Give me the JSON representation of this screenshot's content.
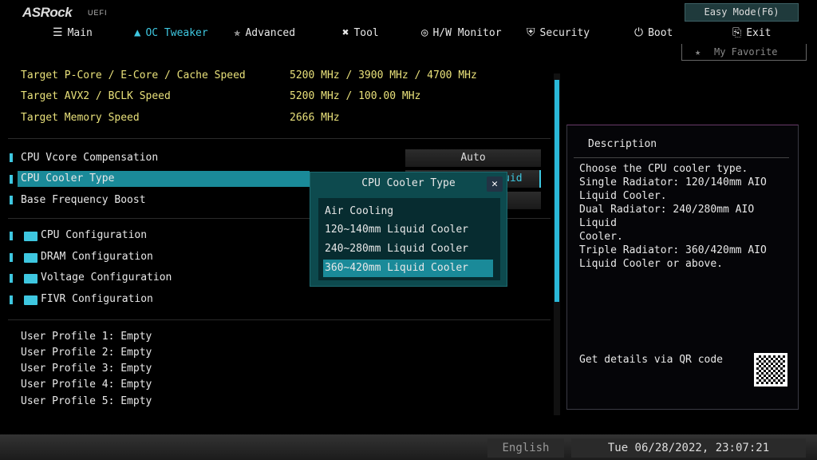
{
  "brand": {
    "logo": "ASRock",
    "sub": "UEFI"
  },
  "easy_mode": "Easy Mode(F6)",
  "favorite": "My Favorite",
  "nav": [
    {
      "label": "Main",
      "icon": "list-icon"
    },
    {
      "label": "OC Tweaker",
      "icon": "rocket-icon",
      "active": true
    },
    {
      "label": "Advanced",
      "icon": "star-icon"
    },
    {
      "label": "Tool",
      "icon": "tools-icon"
    },
    {
      "label": "H/W Monitor",
      "icon": "monitor-icon"
    },
    {
      "label": "Security",
      "icon": "shield-icon"
    },
    {
      "label": "Boot",
      "icon": "power-icon"
    },
    {
      "label": "Exit",
      "icon": "exit-icon"
    }
  ],
  "info": [
    {
      "label": "Target P-Core / E-Core / Cache Speed",
      "value": "5200 MHz / 3900 MHz / 4700 MHz"
    },
    {
      "label": "Target AVX2 / BCLK Speed",
      "value": "5200 MHz / 100.00 MHz"
    },
    {
      "label": "Target Memory Speed",
      "value": "2666 MHz"
    }
  ],
  "settings": [
    {
      "label": "CPU Vcore Compensation",
      "value": "Auto"
    },
    {
      "label": "CPU Cooler Type",
      "value": "360~420mm Liquid Cooler"
    },
    {
      "label": "Base Frequency Boost",
      "value": ""
    }
  ],
  "folders": [
    "CPU Configuration",
    "DRAM Configuration",
    "Voltage Configuration",
    "FIVR Configuration"
  ],
  "profiles": [
    "User Profile 1: Empty",
    "User Profile 2: Empty",
    "User Profile 3: Empty",
    "User Profile 4: Empty",
    "User Profile 5: Empty"
  ],
  "description": {
    "title": "Description",
    "text": "Choose the CPU cooler type.\nSingle Radiator: 120/140mm AIO\nLiquid Cooler.\nDual Radiator: 240/280mm AIO Liquid\nCooler.\nTriple Radiator: 360/420mm AIO\nLiquid Cooler or above.",
    "qr": "Get details via QR code"
  },
  "popup": {
    "title": "CPU Cooler Type",
    "options": [
      "Air Cooling",
      "120~140mm Liquid Cooler",
      "240~280mm Liquid Cooler",
      "360~420mm Liquid Cooler"
    ],
    "selected": 3
  },
  "footer": {
    "language": "English",
    "datetime": "Tue 06/28/2022, 23:07:21"
  },
  "colors": {
    "accent": "#3ec7e0",
    "highlight": "#1a8a99",
    "info_text": "#e8e07a"
  }
}
